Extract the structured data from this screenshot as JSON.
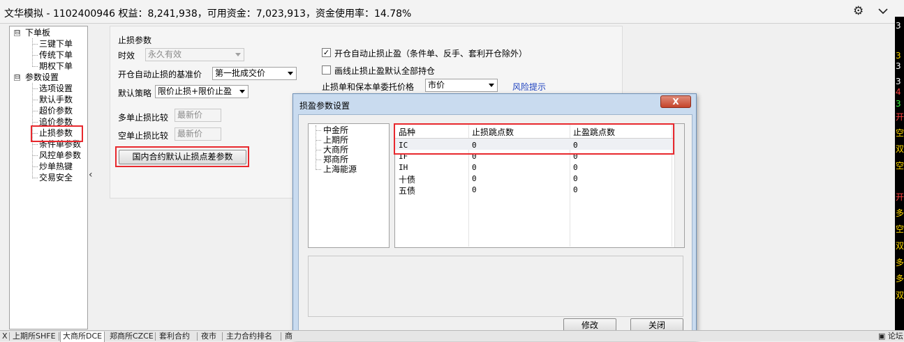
{
  "window": {
    "title": "文华模拟 - 1102400946 权益：8,241,938，可用资金：7,023,913，资金使用率：14.78%",
    "settings_icon": "gear-icon",
    "collapse_icon": "chevron-down-icon"
  },
  "tree": {
    "groups": [
      {
        "label": "下单板",
        "toggle": "⊟",
        "children": [
          "三键下单",
          "传统下单",
          "期权下单"
        ]
      },
      {
        "label": "参数设置",
        "toggle": "⊟",
        "children": [
          "选项设置",
          "默认手数",
          "超价参数",
          "追价参数",
          "止损参数",
          "条件单参数",
          "风控单参数",
          "炒单热键",
          "交易安全"
        ]
      }
    ],
    "selected": "止损参数",
    "collapse_arrow": "‹"
  },
  "stop_params": {
    "section_title": "止损参数",
    "validity_label": "时效",
    "validity_value": "永久有效",
    "base_price_label": "开仓自动止损的基准价",
    "base_price_value": "第一批成交价",
    "default_strategy_label": "默认策略",
    "default_strategy_value": "限价止损+限价止盈",
    "long_compare_label": "多单止损比较",
    "long_compare_value": "最新价",
    "short_compare_label": "空单止损比较",
    "short_compare_value": "最新价",
    "domestic_button": "国内合约默认止损点差参数",
    "auto_stop_checked": true,
    "auto_stop_label": "开仓自动止损止盈（条件单、反手、套利开仓除外）",
    "draw_line_checked": false,
    "draw_line_label": "画线止损止盈默认全部持仓",
    "order_price_label": "止损单和保本单委托价格",
    "order_price_value": "市价",
    "risk_link": "风险提示"
  },
  "dialog": {
    "title": "损盈参数设置",
    "close": "X",
    "exchanges": [
      "中金所",
      "上期所",
      "大商所",
      "郑商所",
      "上海能源"
    ],
    "columns": [
      "品种",
      "止损跳点数",
      "止盈跳点数"
    ],
    "rows": [
      [
        "IC",
        "0",
        "0"
      ],
      [
        "IF",
        "0",
        "0"
      ],
      [
        "IH",
        "0",
        "0"
      ],
      [
        "十债",
        "0",
        "0"
      ],
      [
        "五债",
        "0",
        "0"
      ]
    ],
    "modify_button": "修改",
    "close_button": "关闭"
  },
  "bottom_tabs": [
    "X",
    "上期所SHFE",
    "大商所DCE",
    "郑商所CZCE",
    "套利合约",
    "夜市",
    "主力合约排名",
    "商"
  ],
  "active_tab": "大商所DCE",
  "forum_label": "论坛",
  "right_strip": [
    "3",
    "3",
    "3",
    "3",
    "4",
    "3",
    "开",
    "空",
    "双",
    "空",
    "开",
    "多",
    "空",
    "双",
    "多",
    "多",
    "双"
  ],
  "colors": {
    "highlight_red": "#e8282d",
    "dialog_frame": "#c9dbef",
    "link_blue": "#1a3fbf"
  }
}
